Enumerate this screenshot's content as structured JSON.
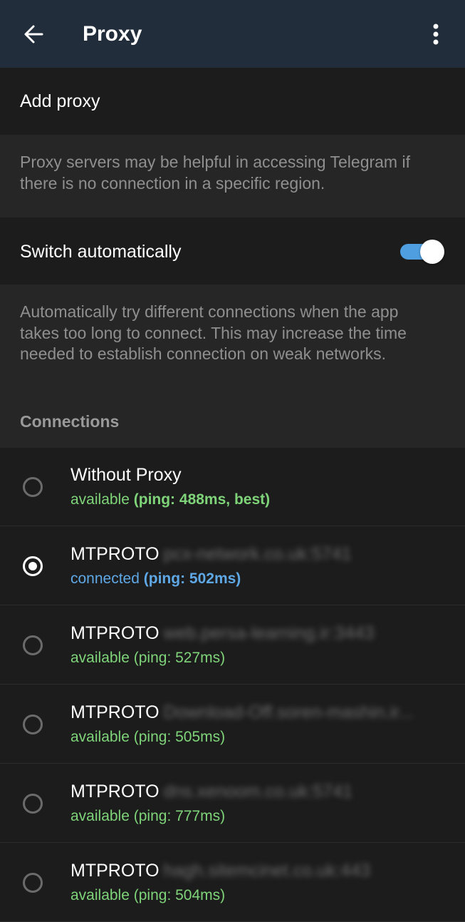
{
  "header": {
    "title": "Proxy",
    "back_icon": "arrow-left-icon",
    "menu_icon": "more-vertical-icon"
  },
  "add_proxy_label": "Add proxy",
  "proxy_info": "Proxy servers may be helpful in accessing Telegram if there is no connection in a specific region.",
  "switch_auto": {
    "label": "Switch automatically",
    "enabled": true
  },
  "switch_info": "Automatically try different connections when the app takes too long to connect. This may increase the time needed to establish connection on weak networks.",
  "connections_title": "Connections",
  "connections": [
    {
      "name": "Without Proxy",
      "host": "",
      "status": "available",
      "ping": "(ping: 488ms, best)",
      "selected": false,
      "ping_bold": true,
      "color": "green"
    },
    {
      "name": "MTPROTO",
      "host": "pcx-network.co.uk:5741",
      "status": "connected",
      "ping": "(ping: 502ms)",
      "selected": true,
      "ping_bold": true,
      "color": "blue"
    },
    {
      "name": "MTPROTO",
      "host": "web.persa-learning.ir:3443",
      "status": "available",
      "ping": "(ping: 527ms)",
      "selected": false,
      "ping_bold": false,
      "color": "green"
    },
    {
      "name": "MTPROTO",
      "host": "Download-Off.soren-mashin.ir...",
      "status": "available",
      "ping": "(ping: 505ms)",
      "selected": false,
      "ping_bold": false,
      "color": "green"
    },
    {
      "name": "MTPROTO",
      "host": "dns.xenoom.co.uk:5741",
      "status": "available",
      "ping": "(ping: 777ms)",
      "selected": false,
      "ping_bold": false,
      "color": "green"
    },
    {
      "name": "MTPROTO",
      "host": "hagh.sitemcinet.co.uk:443",
      "status": "available",
      "ping": "(ping: 504ms)",
      "selected": false,
      "ping_bold": false,
      "color": "green"
    }
  ],
  "colors": {
    "header_bg": "#212d3b",
    "accent": "#4e9ee0",
    "available_green": "#7fd47a",
    "connected_blue": "#5fa8e6"
  }
}
